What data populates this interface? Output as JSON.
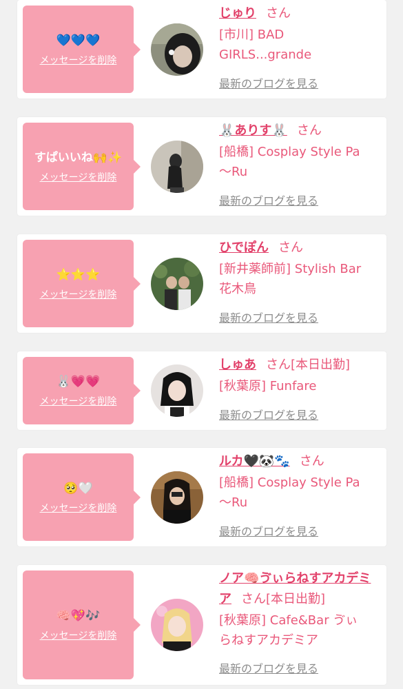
{
  "delete_label": "メッセージを削除",
  "blog_label": "最新のブログを見る",
  "san_label": "さん",
  "colors": {
    "bubble": "#f7a1b1",
    "name": "#e2416a",
    "text": "#e9587a",
    "link_gray": "#8c8c8c"
  },
  "cards": [
    {
      "message": "💙💙💙",
      "name": "じゅり",
      "status": "",
      "shop_lines": [
        "[市川] BAD",
        "GIRLS...grande"
      ]
    },
    {
      "message": "すぱいいね🙌✨",
      "name": "🐰ありす🐰",
      "status": "",
      "shop_lines": [
        "[船橋] Cosplay Style Pa",
        "〜Ru"
      ]
    },
    {
      "message": "⭐⭐⭐",
      "name": "ひでぽん",
      "status": "",
      "shop_lines": [
        "[新井薬師前] Stylish Bar",
        "花木鳥"
      ]
    },
    {
      "message": "🐰💗💗",
      "name": "しゅあ",
      "status": "[本日出勤]",
      "shop_lines": [
        "[秋葉原] Funfare"
      ]
    },
    {
      "message": "🥺🤍",
      "name": "ルカ🖤🐼🐾",
      "status": "",
      "shop_lines": [
        "[船橋] Cosplay Style Pa",
        "〜Ru"
      ]
    },
    {
      "message": "🧠💖🎶",
      "name": "ノア🧠ゔぃらねすアカデミア",
      "status": "[本日出勤]",
      "shop_lines": [
        "[秋葉原] Cafe&Bar ゔぃ",
        "らねすアカデミア"
      ]
    }
  ]
}
